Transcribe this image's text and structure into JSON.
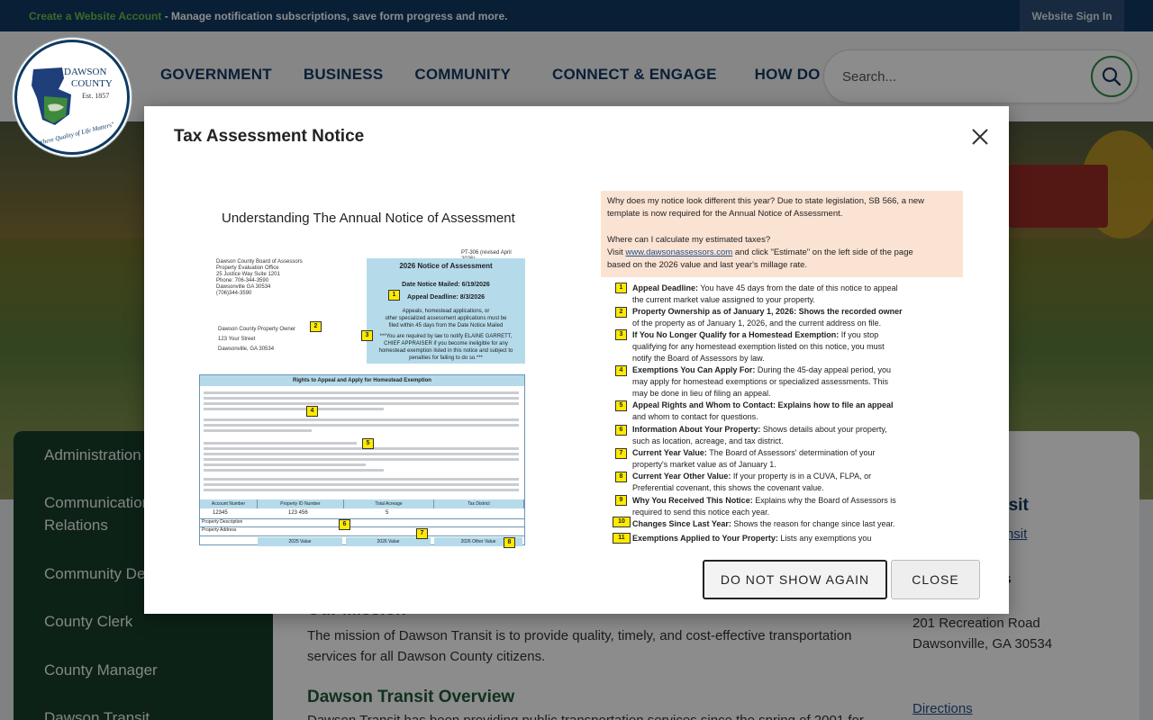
{
  "topbar": {
    "link": "Create a Website Account",
    "message": " - Manage notification subscriptions, save form progress and more.",
    "sign_in": "Website Sign In"
  },
  "logo": {
    "line1": "DAWSON",
    "line2": "COUNTY",
    "line3": "Est. 1857",
    "motto": "\"Where Quality of Life Matters\""
  },
  "nav": [
    "GOVERNMENT",
    "BUSINESS",
    "COMMUNITY",
    "CONNECT & ENGAGE",
    "HOW DO I..."
  ],
  "search": {
    "placeholder": "Search..."
  },
  "sidebar": {
    "items": [
      "Administration",
      "Communication",
      "Relations",
      "Community De",
      "County Clerk",
      "County Manager",
      "Dawson Transit"
    ]
  },
  "main": {
    "mission_title": "Our Mission",
    "mission_text": "The mission of Dawson Transit is to provide quality, timely, and cost-effective transportation services for all Dawson County citizens.",
    "overview_title": "Dawson Transit Overview",
    "overview_text": "Dawson Transit has been providing public transportation services since the spring of 2001 for",
    "right_title": "nsit",
    "right_link": "Transit",
    "address_heading": "ess",
    "address_line1": "201 Recreation Road",
    "address_line2": "Dawsonville, GA 30534",
    "directions": "Directions"
  },
  "modal": {
    "title": "Tax Assessment Notice",
    "dont_show": "DO NOT SHOW AGAIN",
    "close": "CLOSE",
    "notice": {
      "heading": "Understanding The Annual Notice of Assessment",
      "form_id": "PT-306 (revised April 2026)",
      "office": [
        "Dawson County Board of Assessors",
        "Property Evaluation Office",
        "25 Justice Way Suite 1201",
        "Phone: 706-344-3590",
        "Dawsonville GA 30534",
        "(706)344-3590"
      ],
      "box_title": "2026 Notice of Assessment",
      "date_mailed": "Date Notice Mailed: 6/19/2026",
      "appeal_deadline": "Appeal Deadline: 8/3/2026",
      "box_lines": [
        "Appeals, homestead applications, or",
        "other specialized assessment applications must be",
        "filed within 45 days from the Date Notice Mailed",
        "***You are required by law to notify ELAINE GARRETT,",
        "CHIEF APPRAISER if you become ineligible for any",
        "homestead exemption listed in this notice and subject to",
        "penalties for failing to do so.***"
      ],
      "owner": [
        "Dawson County Property Owner",
        "123 Your Street",
        "Dawsonville, GA 30534"
      ],
      "rights_title": "Rights to Appeal and Apply for Homestead Exemption",
      "table_headers": [
        "Account Number",
        "Property ID Number",
        "Total Acreage",
        "Tax District"
      ],
      "table_values": [
        "12345",
        "123 456",
        "5"
      ],
      "row_labels": [
        "Property Description",
        "Property Address"
      ],
      "value_headers": [
        "2025 Value",
        "2026 Value",
        "2026 Other Value"
      ]
    },
    "explain": {
      "pink_lines": [
        "Why does my notice look different this year? Due to state legislation, SB 566, a new",
        "template is now required for the Annual Notice of Assessment.",
        "Where can I calculate my estimated taxes?",
        "and click \"Estimate\" on the left side of the page",
        "based on the 2026 value and last year's millage rate."
      ],
      "visit": "Visit ",
      "site": "www.dawsonassessors.com",
      "items": [
        {
          "n": "1",
          "b": "Appeal Deadline:",
          "t": " You have 45 days from the date of this notice to appeal",
          "t2": "the current market value assigned to your property."
        },
        {
          "n": "2",
          "b": "Property Ownership as of January 1, 2026: Shows the recorded owner",
          "t": "",
          "t2": "of the property as of January 1, 2026, and the current address on file."
        },
        {
          "n": "3",
          "b": "If You No Longer Qualify for a Homestead Exemption:",
          "t": " If you stop",
          "t2": "qualifying for any homestead exemption listed on this notice, you must",
          "t3": "notify the Board of Assessors by law."
        },
        {
          "n": "4",
          "b": "Exemptions You Can Apply For:",
          "t": " During the 45-day appeal period, you",
          "t2": "may apply for homestead exemptions or specialized assessments. This",
          "t3": "may be done in lieu of filing an appeal."
        },
        {
          "n": "5",
          "b": "Appeal Rights and Whom to Contact: Explains how to file an appeal",
          "t": "",
          "t2": "and whom to contact for questions."
        },
        {
          "n": "6",
          "b": "Information About Your Property:",
          "t": " Shows details about your property,",
          "t2": "such as location, acreage, and tax district."
        },
        {
          "n": "7",
          "b": "Current Year Value:",
          "t": " The Board of Assessors' determination of your",
          "t2": "property's market value as of January 1."
        },
        {
          "n": "8",
          "b": "Current Year Other Value:",
          "t": " If your property is in a CUVA, FLPA, or",
          "t2": "Preferential covenant, this shows the covenant value."
        },
        {
          "n": "9",
          "b": "Why You Received This Notice:",
          "t": " Explains why the Board of Assessors is",
          "t2": "required to send this notice each year."
        },
        {
          "n": "10",
          "b": "Changes Since Last Year:",
          "t": " Shows the reason for change since last year.",
          "t2": ""
        },
        {
          "n": "11",
          "b": "Exemptions Applied to Your Property:",
          "t": " Lists any exemptions you",
          "t2": ""
        }
      ]
    }
  },
  "colors": {
    "topbar": "#0f3a63",
    "nav_text": "#133a63",
    "accent_green": "#6cc04a",
    "sidebar": "#163f2b",
    "badge": "#ffea00"
  }
}
